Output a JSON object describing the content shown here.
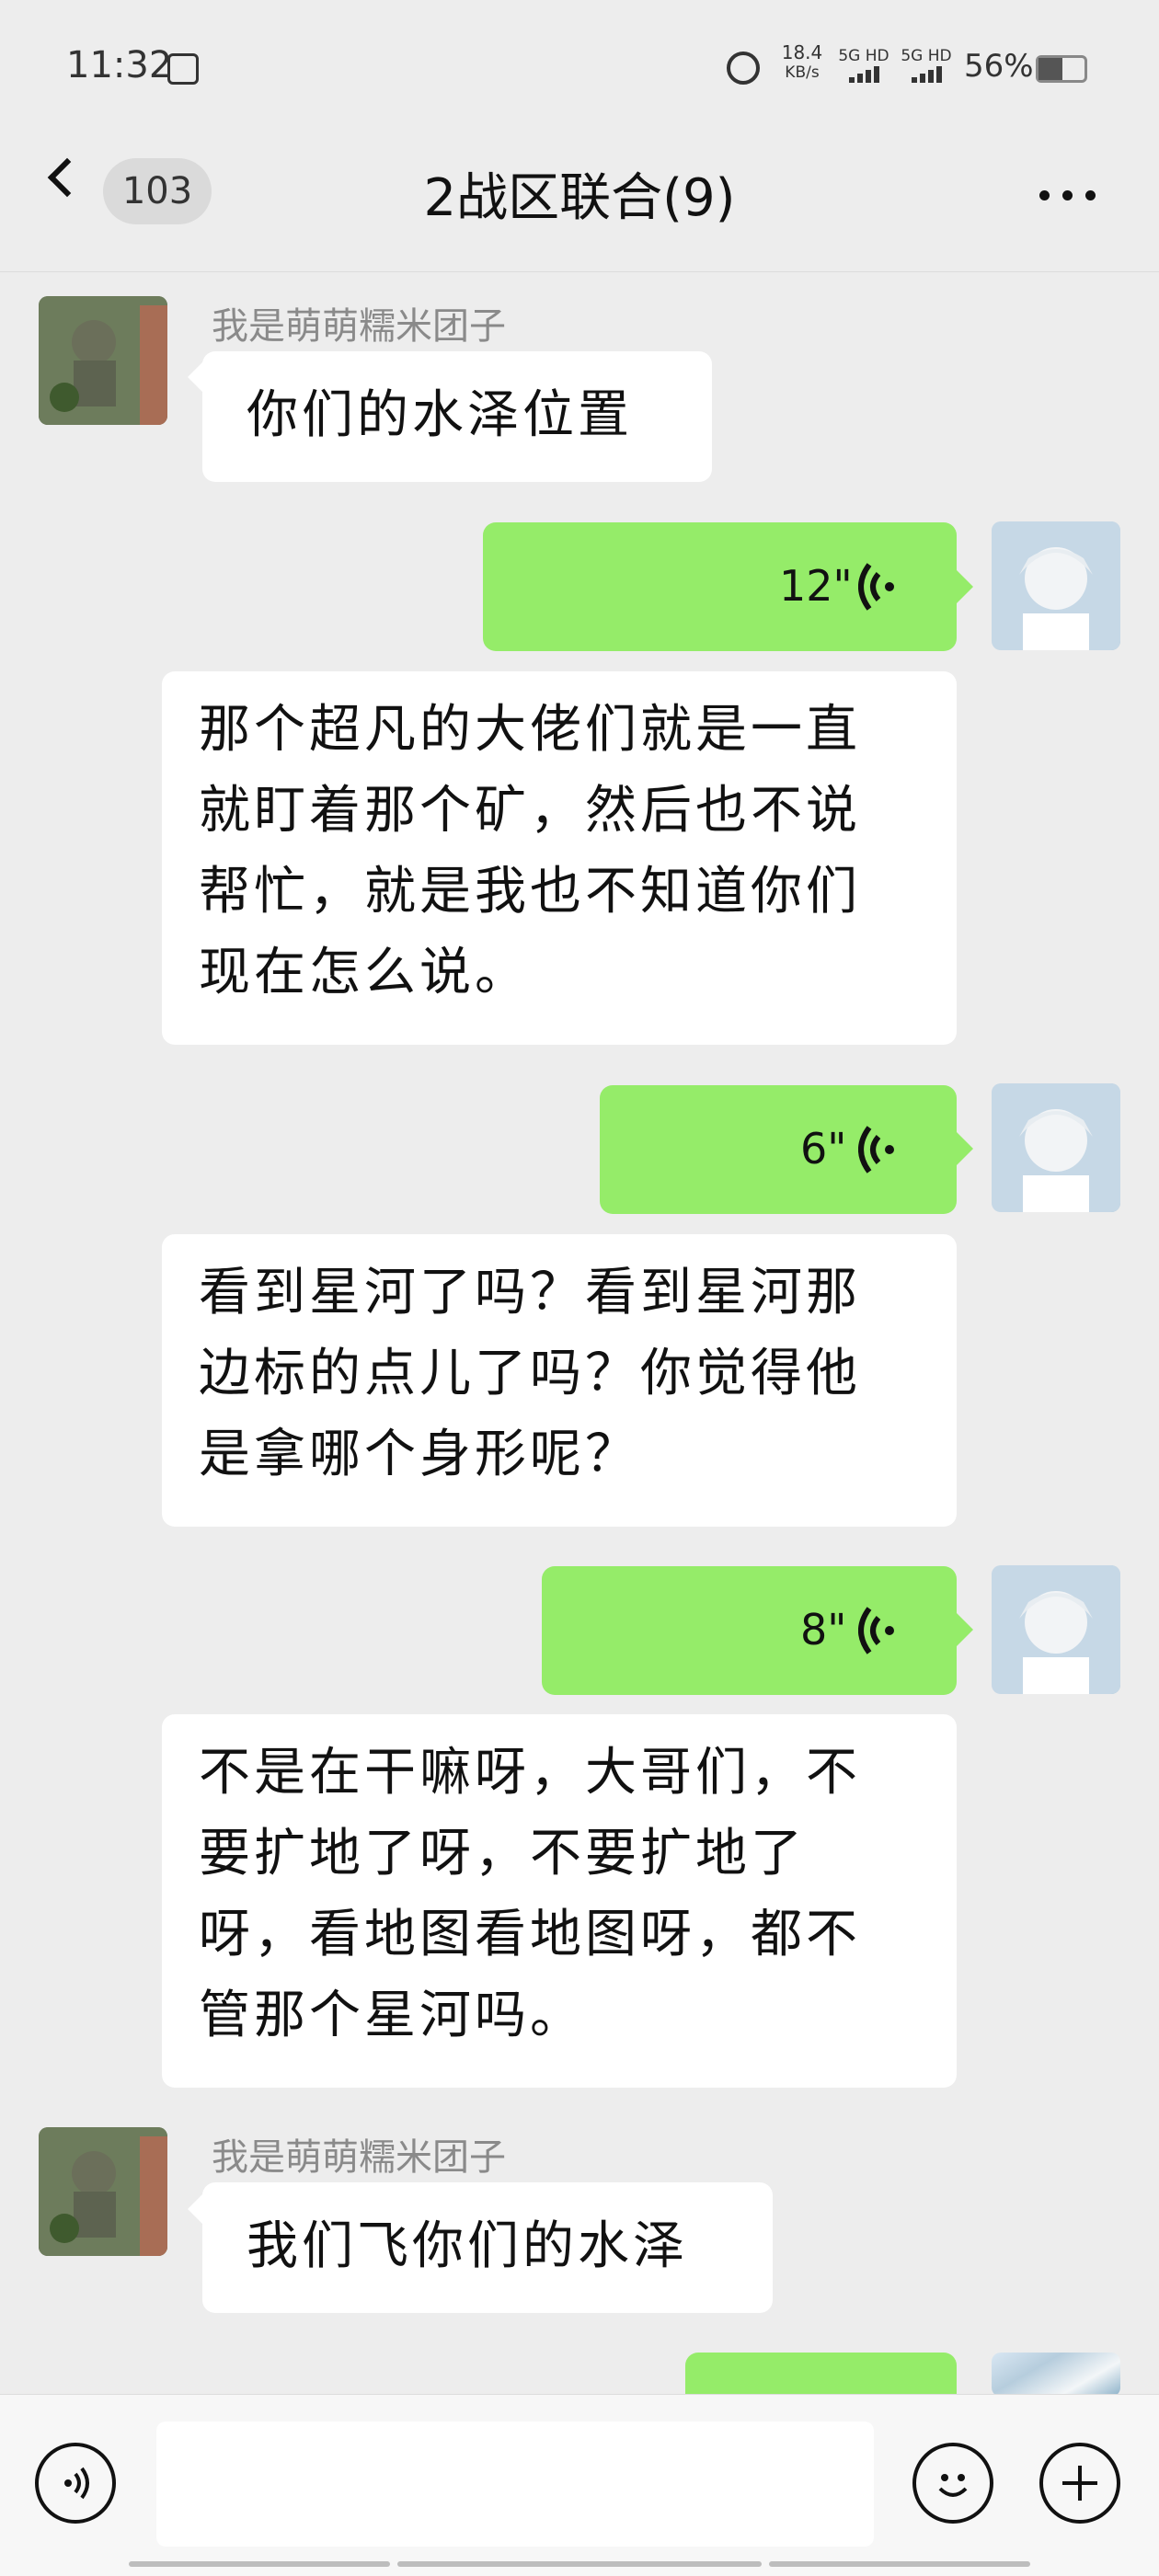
{
  "status_bar": {
    "time": "11:32",
    "net_speed_value": "18.4",
    "net_speed_unit": "KB/s",
    "signal_1": "5G HD",
    "signal_2": "5G HD",
    "battery": "56%"
  },
  "header": {
    "unread_count": "103",
    "title": "2战区联合(9)"
  },
  "messages": [
    {
      "sender": "我是萌萌糯米团子",
      "side": "left",
      "type": "text",
      "text": "你们的水泽位置"
    },
    {
      "side": "right",
      "type": "voice",
      "duration": "12\""
    },
    {
      "side": "right",
      "type": "transcript",
      "lines": [
        "那个超凡的大佬们就是一直",
        "就盯着那个矿，然后也不说",
        "帮忙，就是我也不知道你们",
        "现在怎么说。"
      ]
    },
    {
      "side": "right",
      "type": "voice",
      "duration": "6\""
    },
    {
      "side": "right",
      "type": "transcript",
      "lines": [
        "看到星河了吗？看到星河那",
        "边标的点儿了吗？你觉得他",
        "是拿哪个身形呢？"
      ]
    },
    {
      "side": "right",
      "type": "voice",
      "duration": "8\""
    },
    {
      "side": "right",
      "type": "transcript",
      "lines": [
        "不是在干嘛呀，大哥们，不",
        "要扩地了呀，不要扩地了",
        "呀，看地图看地图呀，都不",
        "管那个星河吗。"
      ]
    },
    {
      "sender": "我是萌萌糯米团子",
      "side": "left",
      "type": "text",
      "text": "我们飞你们的水泽"
    }
  ],
  "colors": {
    "background": "#ededed",
    "self_bubble": "#95ec69",
    "other_bubble": "#ffffff"
  },
  "icons": [
    "back-chevron-icon",
    "more-icon",
    "voice-wave-icon",
    "voice-input-icon",
    "emoji-icon",
    "plus-icon"
  ]
}
